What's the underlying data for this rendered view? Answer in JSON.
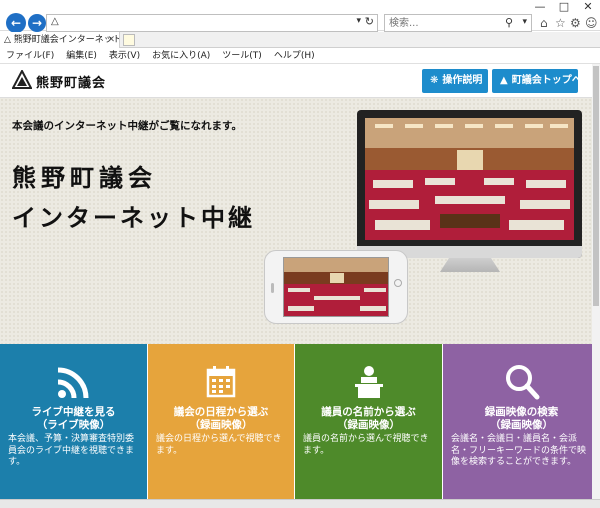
{
  "browser": {
    "address_value": "",
    "search_placeholder": "検索...",
    "tab_title": "熊野町議会インターネット議会...",
    "menu": [
      "ファイル(F)",
      "編集(E)",
      "表示(V)",
      "お気に入り(A)",
      "ツール(T)",
      "ヘルプ(H)"
    ]
  },
  "header": {
    "site_title": "熊野町議会",
    "help_label": "操作説明",
    "top_label": "町議会トップへ"
  },
  "hero": {
    "lead": "本会議のインターネット中継がご覧になれます。",
    "title_line1": "熊野町議会",
    "title_line2": "インターネット中継"
  },
  "tiles": [
    {
      "icon": "wifi-signal-icon",
      "title1": "ライブ中継を見る",
      "title2": "（ライブ映像）",
      "desc": "本会議、予算・決算審査特別委員会のライブ中継を視聴できます。",
      "color": "#1c7fab"
    },
    {
      "icon": "calendar-icon",
      "title1": "議会の日程から選ぶ",
      "title2": "（録画映像）",
      "desc": "議会の日程から選んで視聴できます。",
      "color": "#e6a43c"
    },
    {
      "icon": "speaker-podium-icon",
      "title1": "議員の名前から選ぶ",
      "title2": "（録画映像）",
      "desc": "議員の名前から選んで視聴できます。",
      "color": "#4e8a2a"
    },
    {
      "icon": "magnifier-icon",
      "title1": "録画映像の検索",
      "title2": "（録画映像）",
      "desc": "会議名・会議日・議員名・会派名・フリーキーワードの条件で映像を検索することができます。",
      "color": "#8e62a3"
    }
  ]
}
